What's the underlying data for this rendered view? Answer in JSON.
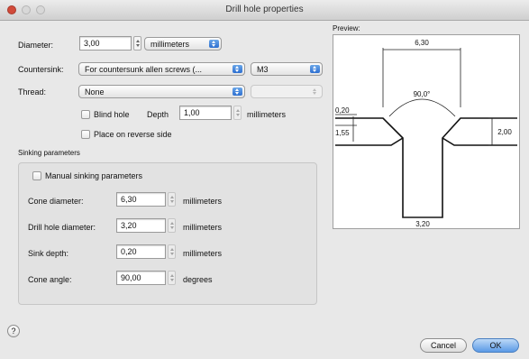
{
  "window": {
    "title": "Drill hole properties"
  },
  "diameter": {
    "label": "Diameter:",
    "value": "3,00",
    "unit": "millimeters"
  },
  "countersink": {
    "label": "Countersink:",
    "type": "For countersunk allen screws (...",
    "size": "M3"
  },
  "thread": {
    "label": "Thread:",
    "value": "None",
    "option2": ""
  },
  "blind_hole": {
    "label": "Blind hole",
    "depth_label": "Depth",
    "depth_value": "1,00",
    "depth_unit": "millimeters"
  },
  "reverse_side": {
    "label": "Place on reverse side"
  },
  "sinking": {
    "section_label": "Sinking parameters",
    "manual_label": "Manual sinking parameters",
    "rows": [
      {
        "label": "Cone diameter:",
        "value": "6,30",
        "unit": "millimeters"
      },
      {
        "label": "Drill hole diameter:",
        "value": "3,20",
        "unit": "millimeters"
      },
      {
        "label": "Sink depth:",
        "value": "0,20",
        "unit": "millimeters"
      },
      {
        "label": "Cone angle:",
        "value": "90,00",
        "unit": "degrees"
      }
    ]
  },
  "preview": {
    "label": "Preview:",
    "dims": {
      "top_width": "6,30",
      "angle": "90,0°",
      "left_upper": "0,20",
      "left_lower": "1,55",
      "right": "2,00",
      "bottom_width": "3,20"
    }
  },
  "buttons": {
    "help": "?",
    "cancel": "Cancel",
    "ok": "OK"
  }
}
